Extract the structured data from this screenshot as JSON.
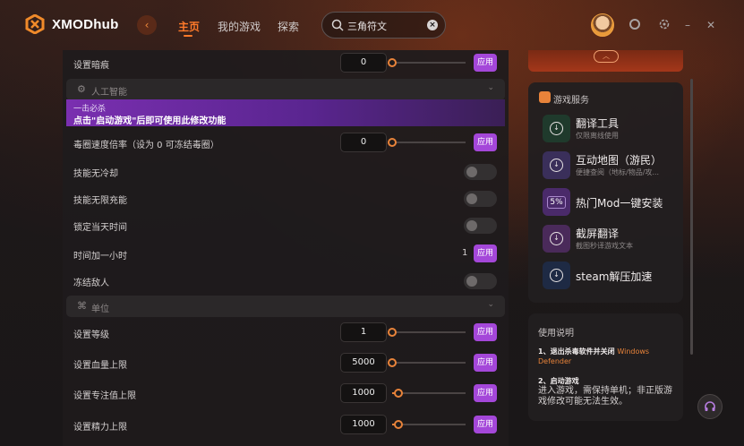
{
  "app": {
    "logo_text": "XMODhub",
    "nav_tabs": [
      {
        "label": "主页",
        "active": true
      },
      {
        "label": "我的游戏",
        "active": false
      },
      {
        "label": "探索",
        "active": false
      }
    ],
    "search_value": "三角符文",
    "accent_color": "#ff7a2a",
    "apply_color": "#a447d9"
  },
  "mods": {
    "top_row": {
      "label": "设置暗痕",
      "value": "0",
      "apply": "应用"
    },
    "sections": [
      {
        "title": "人工智能",
        "icon": "robot-icon"
      },
      {
        "title": "单位",
        "icon": "unit-icon"
      }
    ],
    "banner": {
      "sub": "一击必杀",
      "main": "点击\"启动游戏\"后即可使用此修改功能"
    },
    "rows": [
      {
        "label": "毒圈速度倍率（设为 0 可冻结毒圈）",
        "type": "slider",
        "value": "0",
        "apply": "应用",
        "level": 0
      },
      {
        "label": "技能无冷却",
        "type": "toggle",
        "on": false
      },
      {
        "label": "技能无限充能",
        "type": "toggle",
        "on": false
      },
      {
        "label": "锁定当天时间",
        "type": "toggle",
        "on": false
      },
      {
        "label": "时间加一小时",
        "type": "button",
        "value": "1",
        "apply": "应用"
      },
      {
        "label": "冻结敌人",
        "type": "toggle",
        "on": false
      }
    ],
    "unit_rows": [
      {
        "label": "设置等级",
        "value": "1",
        "apply": "应用",
        "level": 0
      },
      {
        "label": "设置血量上限",
        "value": "5000",
        "apply": "应用",
        "level": 0
      },
      {
        "label": "设置专注值上限",
        "value": "1000",
        "apply": "应用",
        "level": 0.08
      },
      {
        "label": "设置精力上限",
        "value": "1000",
        "apply": "应用",
        "level": 0.08
      }
    ]
  },
  "services": {
    "title": "游戏服务",
    "items": [
      {
        "name": "翻译工具",
        "desc": "仅限离线使用",
        "icon": "download-icon",
        "color": "#1f3a2c"
      },
      {
        "name": "互动地图（游民）",
        "desc": "便捷查阅（地标/物品/攻...",
        "icon": "download-icon",
        "color": "#3a2f5a"
      },
      {
        "name": "热门Mod一键安装",
        "desc": "",
        "icon": "percent-icon",
        "badge": "5%",
        "color": "#4a2a6a"
      },
      {
        "name": "截屏翻译",
        "desc": "截图秒译游戏文本",
        "icon": "download-icon",
        "color": "#4a2a5a"
      },
      {
        "name": "steam解压加速",
        "desc": "",
        "icon": "download-icon",
        "color": "#1e2a44"
      }
    ]
  },
  "instructions": {
    "title": "使用说明",
    "step1_prefix": "1、退出杀毒软件并关闭 ",
    "step1_highlight": "Windows Defender",
    "step2_title": "2、启动游戏",
    "step2_body": "进入游戏，需保持单机；非正版游戏修改可能无法生效。"
  }
}
